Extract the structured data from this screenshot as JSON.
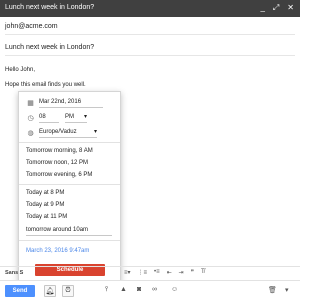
{
  "window": {
    "title": "Lunch next week in London?",
    "minimize_icon": "minimize-icon",
    "expand_icon": "expand-icon",
    "close_icon": "close-icon"
  },
  "compose": {
    "to": "john@acme.com",
    "subject": "Lunch next week in London?",
    "body_lines": [
      "Hello John,",
      "Hope this email finds you well."
    ]
  },
  "schedule": {
    "date": "Mar 22nd, 2016",
    "hour": "08",
    "ampm": "PM",
    "timezone": "Europe/Vaduz",
    "group1": [
      "Tomorrow morning, 8 AM",
      "Tomorrow noon, 12 PM",
      "Tomorrow evening, 6 PM"
    ],
    "group2": [
      "Today at 8 PM",
      "Today at 9 PM",
      "Today at 11 PM"
    ],
    "custom_text": "tomorrow around 10am",
    "last_selected": "March 23, 2016 9:47am",
    "button": "Schedule"
  },
  "format_bar": {
    "font": "Sans S"
  },
  "toolbar": {
    "send": "Send"
  },
  "colors": {
    "titlebar": "#404040",
    "send": "#4d90fe",
    "schedule": "#d9432f",
    "link": "#4a86e8"
  }
}
